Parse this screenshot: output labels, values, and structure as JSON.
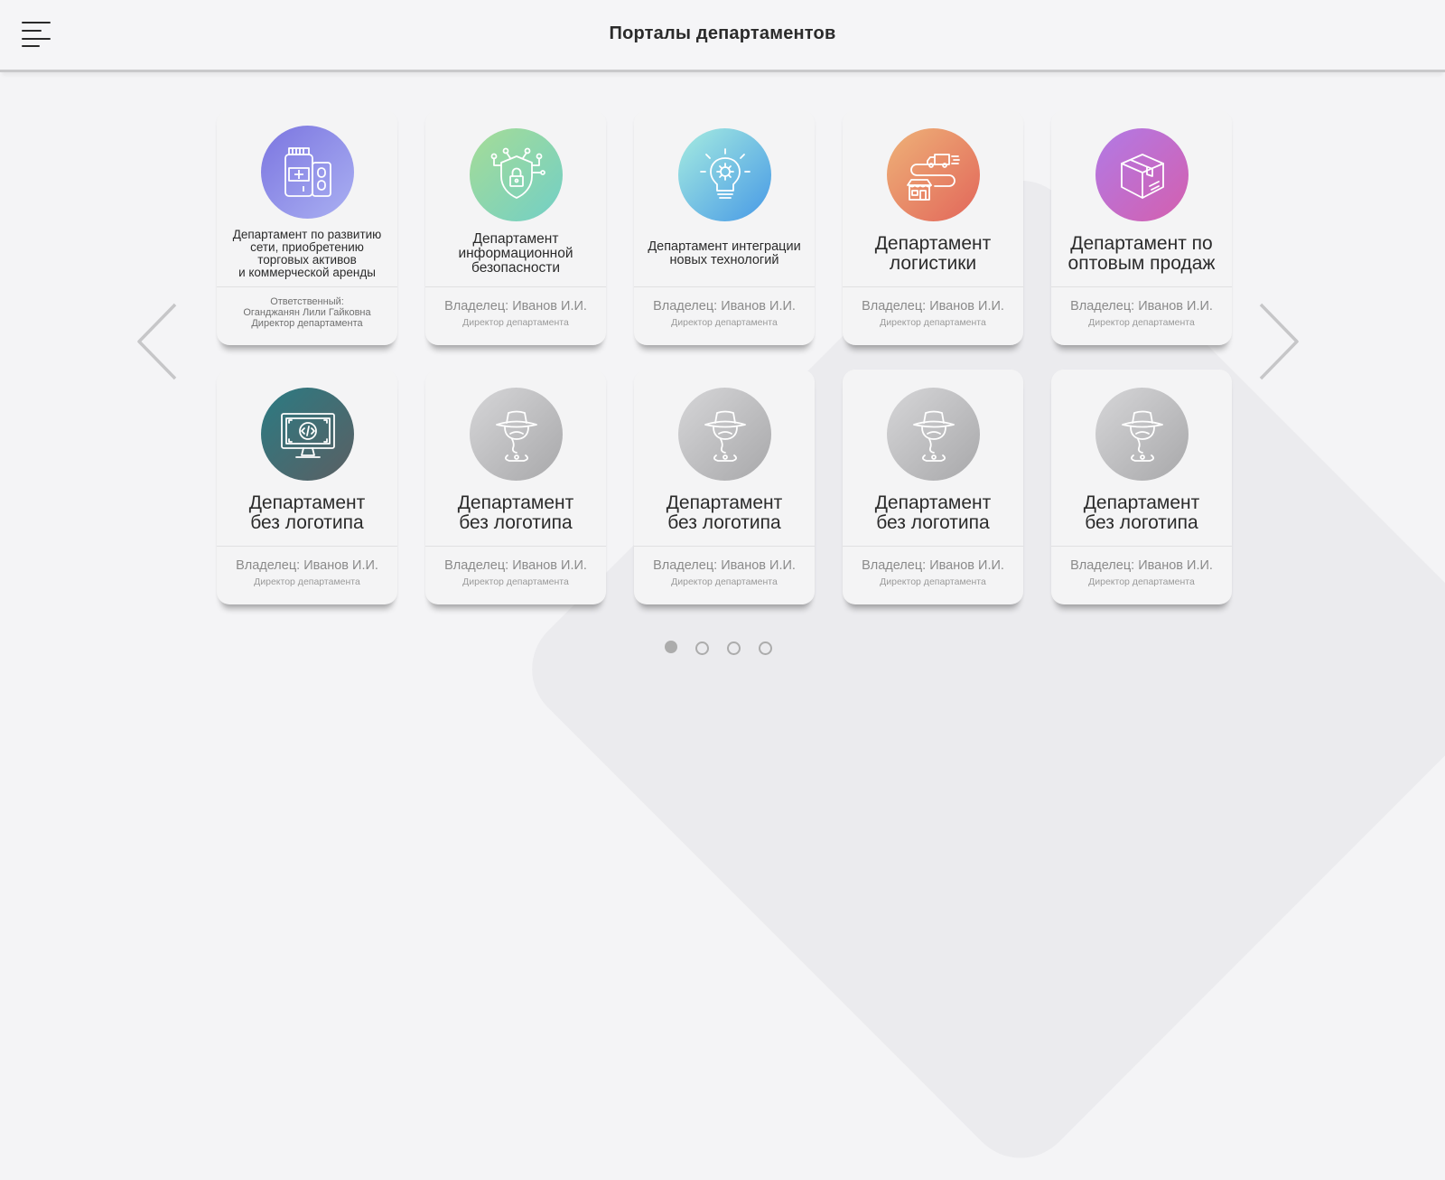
{
  "header": {
    "title": "Порталы департаментов"
  },
  "departments": [
    {
      "name": "Департамент по развитию\nсети, приобретению\nторговых активов\nи коммерческой аренды",
      "responsible_label": "Ответственный:",
      "responsible_name": "Оганджанян Лили Гайковна",
      "role": "Директор департамента",
      "icon": "medicine-icon"
    },
    {
      "name": "Департамент\nинформационной\nбезопасности",
      "owner": "Владелец: Иванов И.И.",
      "role": "Директор департамента",
      "icon": "shield-lock-icon"
    },
    {
      "name": "Департамент интеграции\nновых технологий",
      "owner": "Владелец: Иванов И.И.",
      "role": "Директор департамента",
      "icon": "lightbulb-gear-icon"
    },
    {
      "name": "Департамент\nлогистики",
      "owner": "Владелец: Иванов И.И.",
      "role": "Директор департамента",
      "icon": "truck-route-icon"
    },
    {
      "name": "Департамент по\nоптовым продаж",
      "owner": "Владелец: Иванов И.И.",
      "role": "Директор департамента",
      "icon": "box-icon"
    },
    {
      "name": "Департамент\nбез логотипа",
      "owner": "Владелец: Иванов И.И.",
      "role": "Директор департамента",
      "icon": "monitor-code-icon"
    },
    {
      "name": "Департамент\nбез логотипа",
      "owner": "Владелец: Иванов И.И.",
      "role": "Директор департамента",
      "icon": "incognito-icon"
    },
    {
      "name": "Департамент\nбез логотипа",
      "owner": "Владелец: Иванов И.И.",
      "role": "Директор департамента",
      "icon": "incognito-icon"
    },
    {
      "name": "Департамент\nбез логотипа",
      "owner": "Владелец: Иванов И.И.",
      "role": "Директор департамента",
      "icon": "incognito-icon"
    },
    {
      "name": "Департамент\nбез логотипа",
      "owner": "Владелец: Иванов И.И.",
      "role": "Директор департамента",
      "icon": "incognito-icon"
    }
  ],
  "pagination": {
    "pages": 4,
    "active_page": 1
  },
  "colors": {
    "medicine": [
      "#7b75e0",
      "#aab0f2"
    ],
    "shield": [
      "#a6dc96",
      "#72cfc6"
    ],
    "bulb": [
      "#a6ece0",
      "#4799e6"
    ],
    "truck": [
      "#eeb278",
      "#e2665a"
    ],
    "box": [
      "#b17ae6",
      "#d45fae"
    ],
    "monitor": [
      "#2b7b83",
      "#5b5f63"
    ],
    "incognito": [
      "#d6d6d8",
      "#a8a8aa"
    ]
  }
}
